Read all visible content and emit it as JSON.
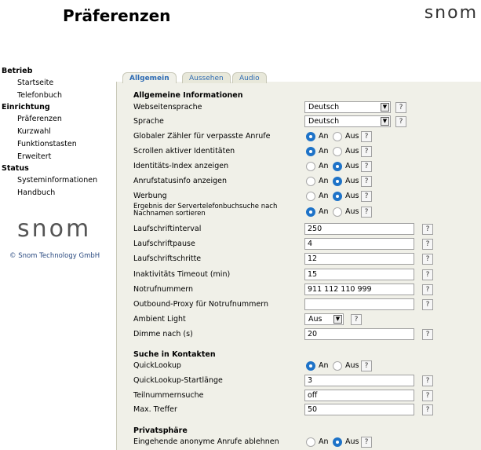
{
  "header": {
    "title": "Präferenzen",
    "logo": "snom"
  },
  "sidebar": {
    "sections": [
      {
        "label": "Betrieb",
        "items": [
          "Startseite",
          "Telefonbuch"
        ]
      },
      {
        "label": "Einrichtung",
        "items": [
          "Präferenzen",
          "Kurzwahl",
          "Funktionstasten",
          "Erweitert"
        ]
      },
      {
        "label": "Status",
        "items": [
          "Systeminformationen",
          "Handbuch"
        ]
      }
    ],
    "logo": "snom",
    "copyright": "© Snom Technology GmbH"
  },
  "tabs": [
    {
      "label": "Allgemein",
      "active": true
    },
    {
      "label": "Aussehen",
      "active": false
    },
    {
      "label": "Audio",
      "active": false
    }
  ],
  "sections": {
    "general": "Allgemeine Informationen",
    "contacts": "Suche in Kontakten",
    "privacy": "Privatsphäre"
  },
  "labels": {
    "on": "An",
    "off": "Aus",
    "help": "?"
  },
  "fields": {
    "web_lang": {
      "label": "Webseitensprache",
      "value": "Deutsch"
    },
    "lang": {
      "label": "Sprache",
      "value": "Deutsch"
    },
    "missed_counter": {
      "label": "Globaler Zähler für verpasste Anrufe",
      "value": "An"
    },
    "scroll_ids": {
      "label": "Scrollen aktiver Identitäten",
      "value": "An"
    },
    "id_index": {
      "label": "Identitäts-Index anzeigen",
      "value": "Aus"
    },
    "call_status": {
      "label": "Anrufstatusinfo anzeigen",
      "value": "Aus"
    },
    "ads": {
      "label": "Werbung",
      "value": "Aus"
    },
    "sort_lastname": {
      "label1": "Ergebnis der Servertelefonbuchsuche nach",
      "label2": "Nachnamen sortieren",
      "value": "An"
    },
    "ticker_interval": {
      "label": "Laufschriftinterval",
      "value": "250"
    },
    "ticker_pause": {
      "label": "Laufschriftpause",
      "value": "4"
    },
    "ticker_steps": {
      "label": "Laufschriftschritte",
      "value": "12"
    },
    "inactivity": {
      "label": "Inaktivitäts Timeout (min)",
      "value": "15"
    },
    "emergency": {
      "label": "Notrufnummern",
      "value": "911 112 110 999"
    },
    "emergency_proxy": {
      "label": "Outbound-Proxy für Notrufnummern",
      "value": ""
    },
    "ambient": {
      "label": "Ambient Light",
      "value": "Aus"
    },
    "dim_after": {
      "label": "Dimme nach (s)",
      "value": "20"
    },
    "quicklookup": {
      "label": "QuickLookup",
      "value": "An"
    },
    "ql_start": {
      "label": "QuickLookup-Startlänge",
      "value": "3"
    },
    "partial": {
      "label": "Teilnummernsuche",
      "value": "off"
    },
    "max_hits": {
      "label": "Max. Treffer",
      "value": "50"
    },
    "anon_reject": {
      "label": "Eingehende anonyme Anrufe ablehnen",
      "value": "Aus"
    }
  }
}
